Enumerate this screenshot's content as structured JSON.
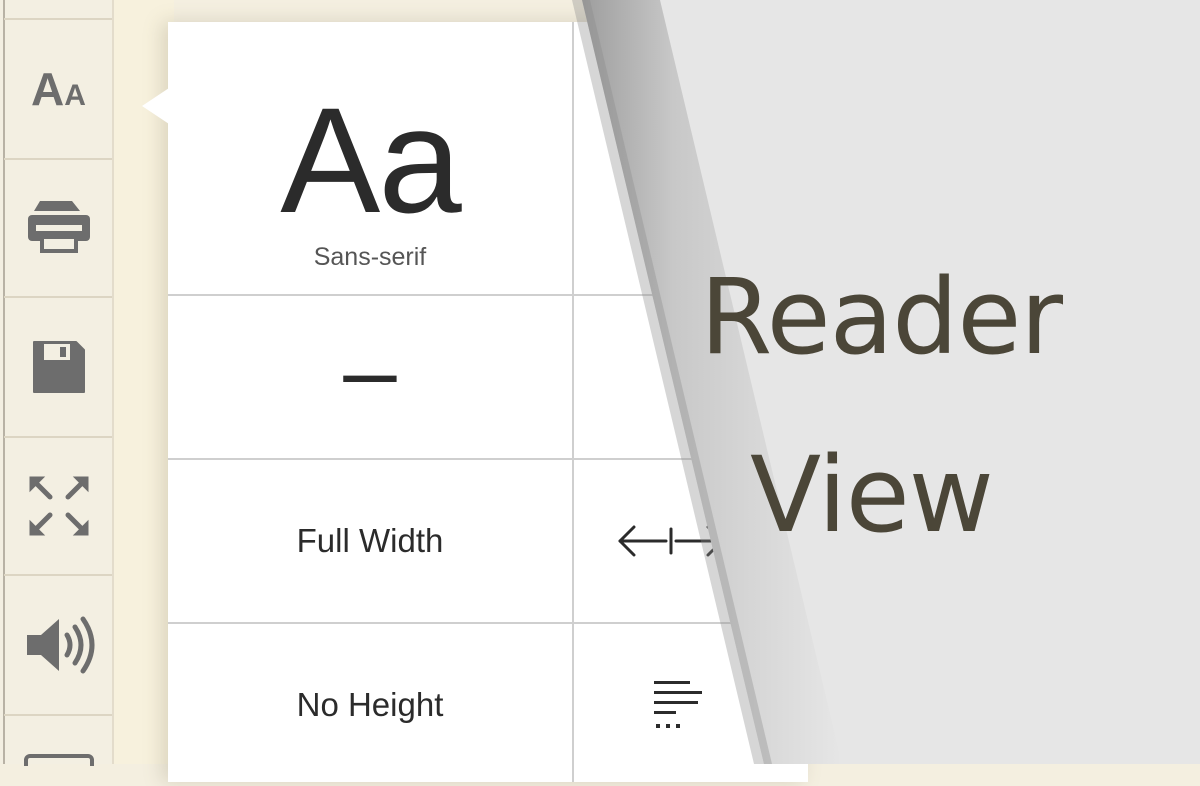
{
  "toolbar": {
    "buttons": [
      {
        "name": "text-style",
        "icon": "text-size-icon",
        "glyph_big": "A",
        "glyph_small": "A"
      },
      {
        "name": "print",
        "icon": "printer-icon"
      },
      {
        "name": "save",
        "icon": "floppy-disk-icon"
      },
      {
        "name": "fullscreen",
        "icon": "expand-arrows-icon"
      },
      {
        "name": "read-aloud",
        "icon": "speaker-icon"
      },
      {
        "name": "more",
        "icon": "screen-icon"
      }
    ]
  },
  "style_panel": {
    "font": {
      "sample": "Aa",
      "name": "Sans-serif"
    },
    "decrease_size_label": "–",
    "width_option_label": "Full Width",
    "height_option_label": "No Height",
    "width_icon": "arrows-width-icon",
    "height_icon": "line-height-icon"
  },
  "overlay": {
    "title_line1": "Reader",
    "title_line2": "View"
  },
  "colors": {
    "toolbar_bg": "#f3efe2",
    "panel_bg": "#ffffff",
    "icon": "#6d6d6d",
    "title_text": "#4b4638",
    "curl_bg": "#e6e6e6"
  }
}
